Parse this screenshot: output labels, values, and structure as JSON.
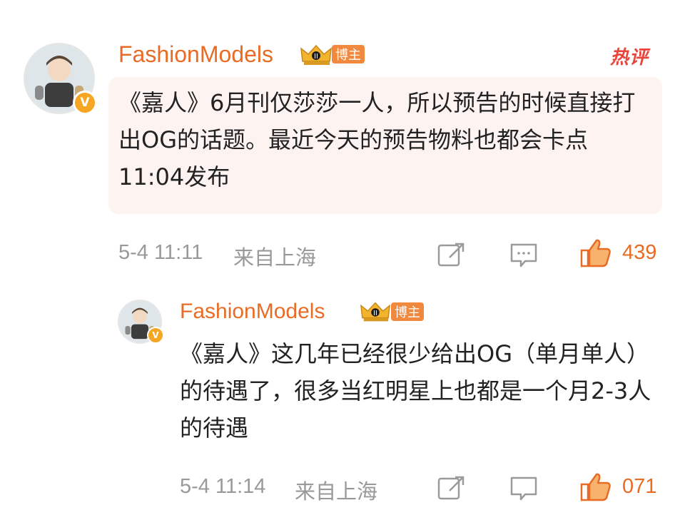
{
  "comment": {
    "username": "FashionModels",
    "role_badge": "博主",
    "hot_label": "热评",
    "text": "《嘉人》6月刊仅莎莎一人，所以预告的时候直接打出OG的话题。最近今天的预告物料也都会卡点11:04发布",
    "time": "5-4 11:11",
    "location": "来自上海",
    "like_count": "439",
    "verified_badge": "V"
  },
  "reply": {
    "username": "FashionModels",
    "role_badge": "博主",
    "text": "《嘉人》这几年已经很少给出OG（单月单人）的待遇了，很多当红明星上也都是一个月2-3人的待遇",
    "time": "5-4 11:14",
    "location": "来自上海",
    "like_count": "071",
    "verified_badge": "V"
  },
  "icons": [
    "avatar",
    "crown-level-icon",
    "share-icon",
    "comment-icon",
    "like-icon"
  ],
  "colors": {
    "accent": "#e86b26",
    "hot": "#e8453c",
    "bubble": "#fdf3f1",
    "meta": "#999999"
  }
}
